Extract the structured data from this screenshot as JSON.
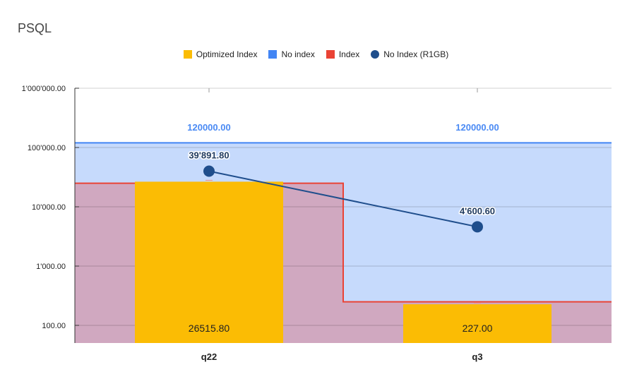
{
  "chart_data": {
    "type": "bar",
    "title": "PSQL",
    "categories": [
      "q22",
      "q3"
    ],
    "y_scale": "log",
    "ylim": [
      50,
      1000000
    ],
    "y_ticks": [
      100,
      1000,
      10000,
      100000,
      1000000
    ],
    "y_tick_labels": [
      "100.00",
      "1'000.00",
      "10'000.00",
      "100'000.00",
      "1'000'000.00"
    ],
    "grid": true,
    "legend_position": "top",
    "series": [
      {
        "name": "Optimized Index",
        "type": "bar",
        "color": "#fbbc04",
        "values": [
          26515.8,
          227.0
        ],
        "labels": [
          "26515.80",
          "227.00"
        ]
      },
      {
        "name": "No index",
        "type": "stepped-area",
        "color": "#4285f4",
        "values": [
          120000.0,
          120000.0
        ],
        "labels": [
          "120000.00",
          "120000.00"
        ]
      },
      {
        "name": "Index",
        "type": "stepped-area",
        "color": "#ea4335",
        "values": [
          25000,
          250
        ]
      },
      {
        "name": "No Index (R1GB)",
        "type": "line",
        "color": "#1f4e8c",
        "values": [
          39891.8,
          4600.6
        ],
        "labels": [
          "39'891.80",
          "4'600.60"
        ]
      }
    ]
  }
}
